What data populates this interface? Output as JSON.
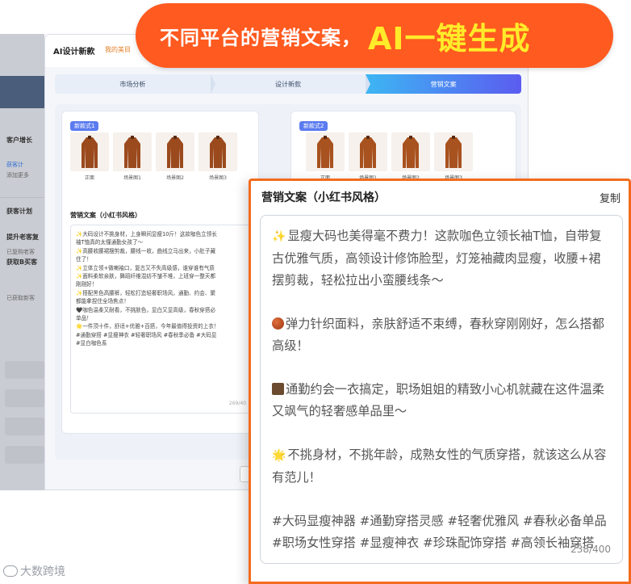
{
  "banner": {
    "text_white": "不同平台的营销文案，",
    "text_yellow": "AI一键生成"
  },
  "left_panel": {
    "section_title": "客户增长",
    "link_text": "获客计",
    "link_sub": "添加更多",
    "plan_title": "获客计划",
    "item1_title": "提升老客复",
    "item1_sub": "已复购老客",
    "item2_title": "获取B买客",
    "item2_sub": "已获取新客"
  },
  "window": {
    "title": "AI设计新款",
    "breadcrumb": "我的美目",
    "steps": [
      "市场分析",
      "设计新款",
      "营销文案"
    ],
    "active_step": 2
  },
  "card1": {
    "badge": "新款式1",
    "thumbs": [
      "正面",
      "场景图1",
      "场景图2",
      "场景图3"
    ],
    "copy_label": "营销文案（小红书风格）",
    "copy_lines": [
      "✨大码设计不挑身材，上身瞬间显瘦10斤！这款咖色立领长",
      "袖T恤真的太懂通勤女孩了～",
      "✨高腰收腰裙摆剪裁，腰线一收，曲线立马出来，小肚子藏",
      "住了！",
      "✨立体立领+微喇袖口，复古又不失高级感，谁穿谁有气质",
      "✨面料柔软亲肤，舞蹈纤维混纺不皱不堆，上班穿一整天都",
      "刚刚好！",
      "✨搭配黑色高腰裤，轻松打造轻奢职场风，通勤、约会、聚",
      "都能拿捏住全场焦点！",
      "🖤咖色温柔又耐看，不挑肤色，显白又显高级，春秋穿搭必",
      "单品！",
      "🌟一件顶十件，舒适+优雅+百搭，今年最值得投资的上衣！",
      "#通勤穿搭 #显瘦神衣 #轻奢职场风 #春秋季必备 #大码显",
      "#显白咖色系"
    ],
    "copy_count": "269/40"
  },
  "card2": {
    "badge": "新款式2",
    "thumbs": [
      "正面",
      "场景图1",
      "场景图2",
      "场景图3"
    ]
  },
  "overlay": {
    "title": "营销文案（小红书风格）",
    "copy_button": "复制",
    "paragraphs": [
      {
        "icon": "sparkle-icon",
        "text": "显瘦大码也美得毫不费力！这款咖色立领长袖T恤，自带复古优雅气质，高领设计修饰脸型，灯笼袖藏肉显瘦，收腰+裙摆剪裁，轻松拉出小蛮腰线条～"
      },
      {
        "icon": "yarn-ball-icon",
        "text": "弹力针织面料，亲肤舒适不束缚，春秋穿刚刚好，怎么搭都高级！"
      },
      {
        "icon": "briefcase-icon",
        "text": "通勤约会一衣搞定，职场姐姐的精致小心机就藏在这件温柔又飒气的轻奢感单品里～"
      },
      {
        "icon": "glowing-star-icon",
        "text": "不挑身材，不挑年龄，成熟女性的气质穿搭，就该这么从容有范儿！"
      }
    ],
    "hashtags": "#大码显瘦神器 #通勤穿搭灵感 #轻奢优雅风 #春秋必备单品 #职场女性穿搭 #显瘦神衣 #珍珠配饰穿搭 #高领长袖穿搭",
    "count": "238/400"
  },
  "watermark": {
    "text": "大数跨境"
  },
  "colors": {
    "banner_bg": "#ff5a1f",
    "banner_highlight": "#ffeb2a",
    "overlay_border": "#f36b1e",
    "active_step_from": "#3db6f3",
    "active_step_to": "#5b5cf0"
  }
}
